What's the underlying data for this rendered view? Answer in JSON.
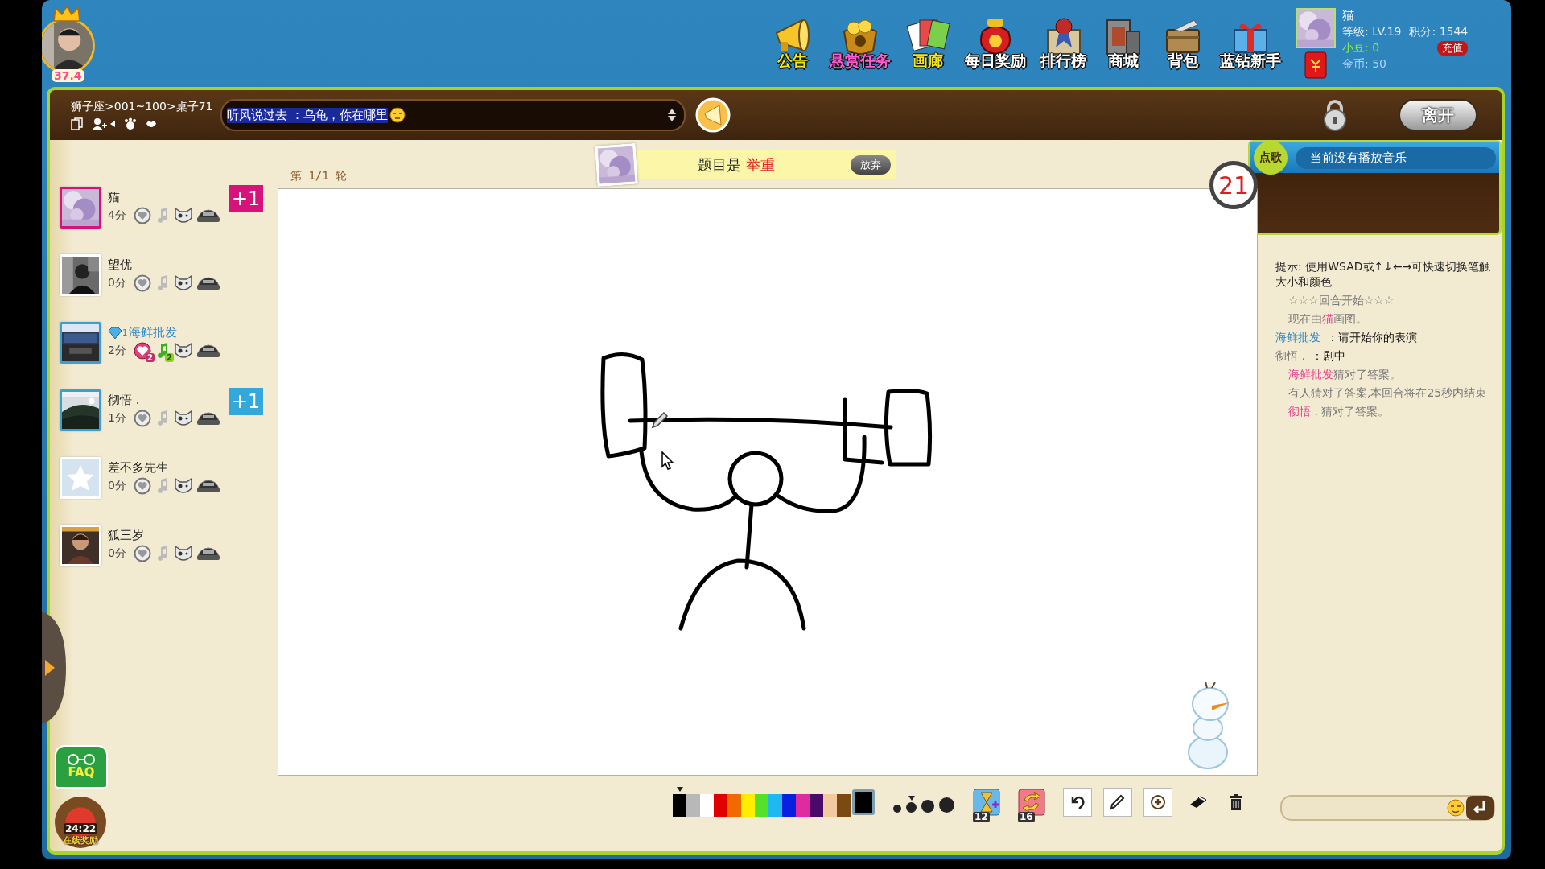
{
  "header": {
    "avatar_level": "37.4",
    "nav": [
      {
        "label": "公告",
        "kind": "megaphone",
        "color": "#f4e61a"
      },
      {
        "label": "悬赏任务",
        "kind": "coins",
        "color": "#ff5ccf"
      },
      {
        "label": "画廊",
        "kind": "cards",
        "color": "#f4e61a"
      },
      {
        "label": "每日奖励",
        "kind": "sack",
        "color": "#ffffff"
      },
      {
        "label": "排行榜",
        "kind": "ribbon",
        "color": "#ffffff"
      },
      {
        "label": "商城",
        "kind": "building",
        "color": "#ffffff"
      },
      {
        "label": "背包",
        "kind": "box",
        "color": "#ffffff"
      },
      {
        "label": "蓝钻新手",
        "kind": "gift",
        "color": "#ffffff"
      }
    ],
    "user": {
      "name": "猫",
      "level_label": "等级:",
      "level": "LV.19",
      "score_label": "积分:",
      "score": "1544",
      "beans_label": "小豆:",
      "beans": "0",
      "recharge": "充值",
      "coins_label": "金币:",
      "coins": "50"
    }
  },
  "room_bar": {
    "path": "狮子座>001~100>桌子71",
    "broadcast": {
      "sender": "听风说过去",
      "message": "：乌龟，你在哪里"
    },
    "leave": "离开"
  },
  "round": "第 1/1 轮",
  "topic": {
    "prefix": "题目是",
    "word": "举重",
    "give_up": "放弃"
  },
  "timer": "21",
  "players": [
    {
      "name": "猫",
      "score": "4分",
      "color": "#d6137a",
      "kind": "picture",
      "bonus": {
        "text": "+1",
        "color": "#d6137a"
      }
    },
    {
      "name": "望优",
      "score": "0分",
      "color": "#ffffff",
      "kind": "picture"
    },
    {
      "name": "海鲜批发",
      "score": "2分",
      "color": "#3aa0d0",
      "kind": "picture",
      "vip_level": "1",
      "likes": "2",
      "notes": "2"
    },
    {
      "name": "彻悟 .",
      "score": "1分",
      "color": "#3aa0d0",
      "kind": "picture",
      "bonus": {
        "text": "+1",
        "color": "#33a8dc"
      }
    },
    {
      "name": "差不多先生",
      "score": "0分",
      "color": "#ffffff",
      "kind": "default"
    },
    {
      "name": "狐三岁",
      "score": "0分",
      "color": "#ffffff",
      "kind": "picture"
    }
  ],
  "side": {
    "faq": "FAQ",
    "reward_time": "24:22",
    "reward_label": "在线奖励"
  },
  "music": {
    "button": "点歌",
    "status": "当前没有播放音乐"
  },
  "chat": [
    {
      "kind": "hint",
      "parts": [
        {
          "text": "提示: 使用WSAD或↑↓←→可快速切换笔触大小和颜色"
        }
      ]
    },
    {
      "kind": "system",
      "parts": [
        {
          "text": "☆☆☆回合开始☆☆☆"
        }
      ]
    },
    {
      "kind": "system",
      "parts": [
        {
          "text": "现在由"
        },
        {
          "text": "猫",
          "color": "#e8438f"
        },
        {
          "text": "画图。"
        }
      ]
    },
    {
      "kind": "user",
      "parts": [
        {
          "text": "海鲜批发",
          "color": "#2f86c8"
        },
        {
          "text": "：请开始你的表演"
        }
      ]
    },
    {
      "kind": "user",
      "parts": [
        {
          "text": "彻悟 .",
          "color": "#777777"
        },
        {
          "text": "：剧中"
        }
      ]
    },
    {
      "kind": "system",
      "parts": [
        {
          "text": "海鲜批发",
          "color": "#e8438f"
        },
        {
          "text": "猜对了答案。"
        }
      ]
    },
    {
      "kind": "system",
      "parts": [
        {
          "text": "有人猜对了答案,本回合将在25秒内结束"
        }
      ]
    },
    {
      "kind": "system",
      "parts": [
        {
          "text": "彻悟",
          "color": "#e8438f"
        },
        {
          "text": " . 猜对了答案。"
        }
      ]
    }
  ],
  "toolbar": {
    "palette": [
      {
        "color": "#000000",
        "selected": true
      },
      {
        "color": "#b8b8b8",
        "selected": false
      },
      {
        "color": "#ffffff",
        "selected": false
      },
      {
        "color": "#e00000",
        "selected": false
      },
      {
        "color": "#f06a00",
        "selected": false
      },
      {
        "color": "#ffee00",
        "selected": false
      },
      {
        "color": "#55e02a",
        "selected": false
      },
      {
        "color": "#20b8f0",
        "selected": false
      },
      {
        "color": "#0a20e0",
        "selected": false
      },
      {
        "color": "#e02aa0",
        "selected": false
      },
      {
        "color": "#4a0a6a",
        "selected": false
      },
      {
        "color": "#f3c9a0",
        "selected": false
      },
      {
        "color": "#7a4a10",
        "selected": false
      }
    ],
    "current": {
      "color": "#000000"
    },
    "pen_sizes": [
      {
        "selected": false
      },
      {
        "selected": true
      },
      {
        "selected": false
      },
      {
        "selected": false
      }
    ],
    "items": [
      {
        "kind": "hourglass",
        "count": "12"
      },
      {
        "kind": "swap",
        "count": "16"
      }
    ],
    "actions": [
      {
        "kind": "undo"
      },
      {
        "kind": "pencil"
      },
      {
        "kind": "add"
      },
      {
        "kind": "eraser"
      },
      {
        "kind": "trash"
      }
    ]
  }
}
